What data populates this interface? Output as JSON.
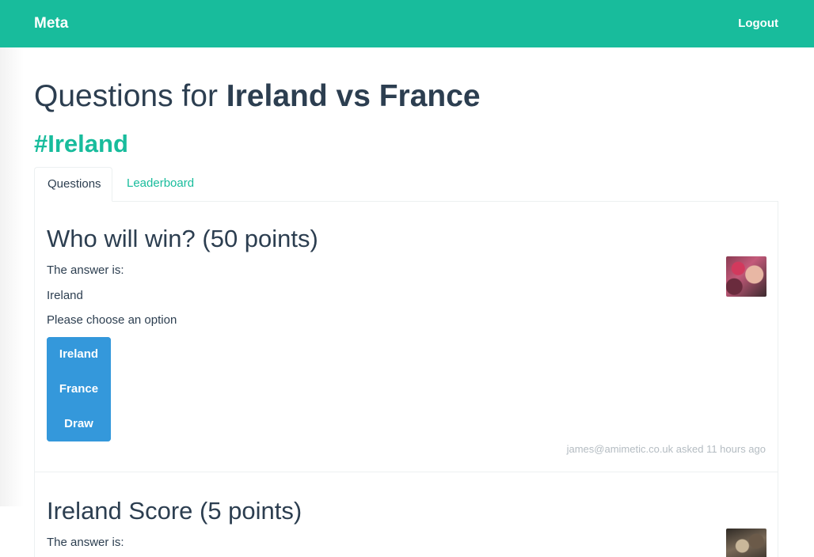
{
  "navbar": {
    "brand": "Meta",
    "logout_label": "Logout"
  },
  "page": {
    "title_prefix": "Questions for",
    "title_match": "Ireland vs France",
    "hashtag": "#Ireland"
  },
  "tabs": [
    {
      "label": "Questions",
      "active": true
    },
    {
      "label": "Leaderboard",
      "active": false
    }
  ],
  "questions": [
    {
      "title": "Who will win? (50 points)",
      "answer_label": "The answer is:",
      "answer": "Ireland",
      "prompt": "Please choose an option",
      "options": [
        "Ireland",
        "France",
        "Draw"
      ],
      "asked_by": "james@amimetic.co.uk asked 11 hours ago",
      "avatar_icon": "user-avatar-photo"
    },
    {
      "title": "Ireland Score (5 points)",
      "answer_label": "The answer is:",
      "avatar_icon": "user-avatar-photo"
    }
  ],
  "colors": {
    "navbar": "#18bc9c",
    "accent": "#18bc9c",
    "button": "#3498db",
    "text": "#2c3e50",
    "muted": "#b4bcc2"
  }
}
